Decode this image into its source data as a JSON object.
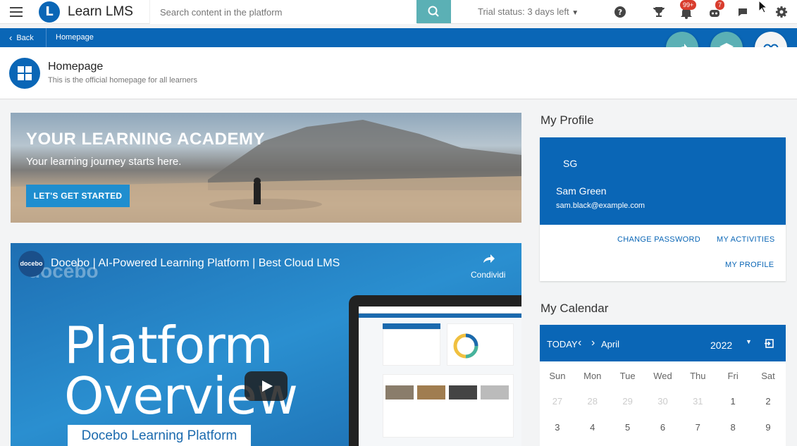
{
  "app": {
    "logo_letter": "L",
    "name": "Learn LMS"
  },
  "search": {
    "placeholder": "Search content in the platform"
  },
  "trial": {
    "label": "Trial status:",
    "value": "3 days left"
  },
  "badges": {
    "notifications": "99+",
    "messages": "7"
  },
  "nav": {
    "back_label": "Back",
    "breadcrumb": "Homepage"
  },
  "page": {
    "title": "Homepage",
    "subtitle": "This is the official homepage for all learners"
  },
  "banner": {
    "title": "YOUR LEARNING ACADEMY",
    "subtitle": "Your learning journey starts here.",
    "cta": "LET'S GET STARTED"
  },
  "video": {
    "logo": "docebo",
    "watermark": "docebo",
    "title": "Docebo | AI-Powered Learning Platform | Best Cloud LMS",
    "share_label": "Condividi",
    "headline_line1": "Platform",
    "headline_line2": "Overview",
    "caption": "Docebo Learning Platform"
  },
  "profile": {
    "section_title": "My Profile",
    "initials": "SG",
    "name": "Sam Green",
    "email": "sam.black@example.com",
    "links": {
      "change_password": "CHANGE PASSWORD",
      "my_activities": "MY ACTIVITIES",
      "my_profile": "MY PROFILE"
    }
  },
  "calendar": {
    "section_title": "My Calendar",
    "today_label": "TODAY",
    "month": "April",
    "year": "2022",
    "weekdays": [
      "Sun",
      "Mon",
      "Tue",
      "Wed",
      "Thu",
      "Fri",
      "Sat"
    ],
    "weeks": [
      [
        "27",
        "28",
        "29",
        "30",
        "31",
        "1",
        "2"
      ],
      [
        "3",
        "4",
        "5",
        "6",
        "7",
        "8",
        "9"
      ]
    ],
    "muted_first_row_count": 5
  },
  "colors": {
    "primary": "#0a66b6",
    "teal": "#5bb0b5",
    "badge_red": "#d93d2e"
  },
  "icons": [
    "hamburger-icon",
    "search-icon",
    "help-icon",
    "trophy-icon",
    "bell-icon",
    "robot-icon",
    "chat-icon",
    "gear-icon",
    "chevron-left-icon",
    "share-icon",
    "graduation-cap-icon",
    "link-icon",
    "dashboard-icon",
    "play-icon"
  ]
}
